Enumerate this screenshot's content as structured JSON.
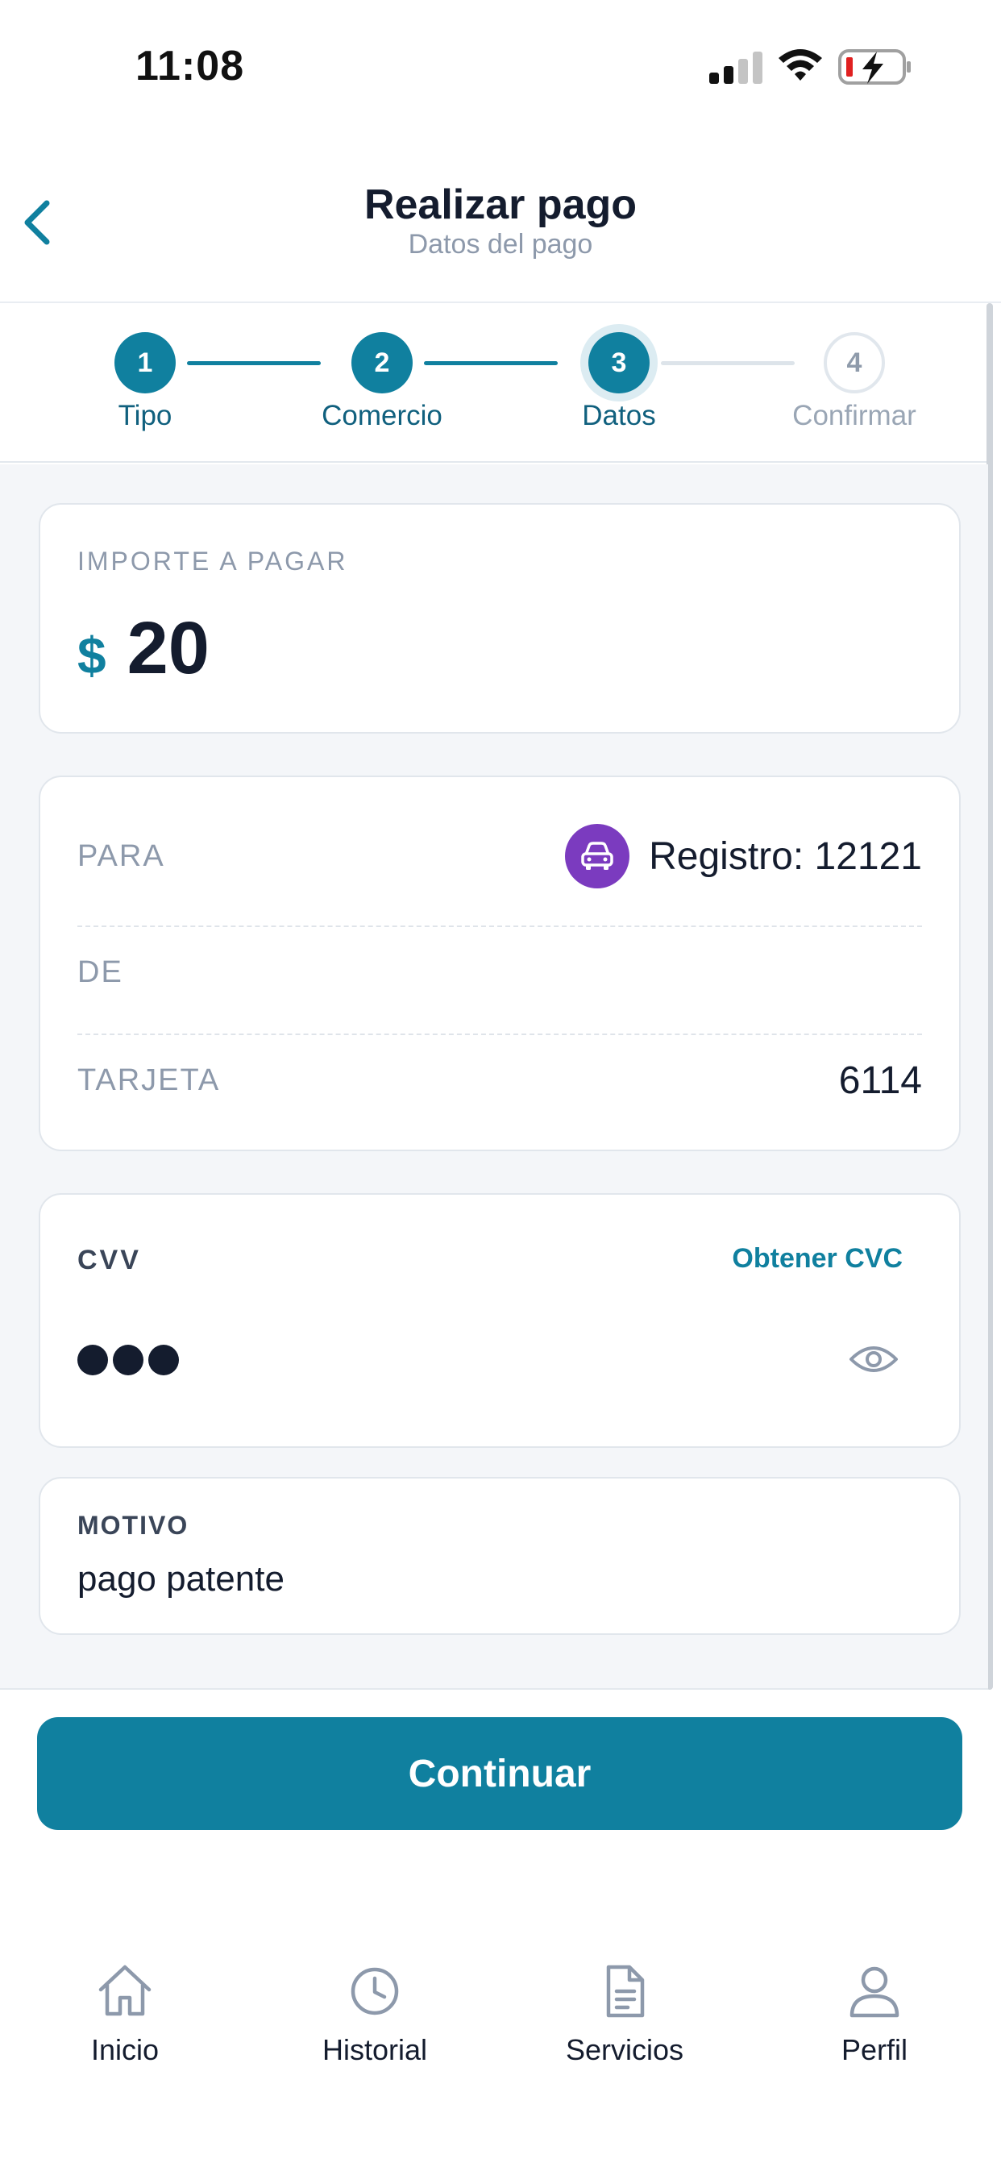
{
  "status_bar": {
    "time": "11:08"
  },
  "header": {
    "title": "Realizar pago",
    "subtitle": "Datos del pago"
  },
  "stepper": {
    "steps": [
      {
        "number": "1",
        "label": "Tipo",
        "state": "done"
      },
      {
        "number": "2",
        "label": "Comercio",
        "state": "done"
      },
      {
        "number": "3",
        "label": "Datos",
        "state": "current"
      },
      {
        "number": "4",
        "label": "Confirmar",
        "state": "todo"
      }
    ]
  },
  "amount": {
    "label": "IMPORTE A PAGAR",
    "currency": "$",
    "value": "20"
  },
  "details": {
    "para_label": "PARA",
    "para_value": "Registro: 12121",
    "de_label": "DE",
    "tarjeta_label": "TARJETA",
    "tarjeta_value": "6114"
  },
  "cvv": {
    "label": "CVV",
    "link": "Obtener CVC",
    "masked_length": 3
  },
  "motivo": {
    "label": "MOTIVO",
    "value": "pago patente"
  },
  "continue_label": "Continuar",
  "tabs": [
    {
      "label": "Inicio",
      "icon": "home-icon"
    },
    {
      "label": "Historial",
      "icon": "clock-icon"
    },
    {
      "label": "Servicios",
      "icon": "document-icon"
    },
    {
      "label": "Perfil",
      "icon": "user-icon"
    }
  ],
  "colors": {
    "accent": "#10809f",
    "car_badge": "#7b3bbf",
    "text_dark": "#141c2e",
    "text_muted": "#8d99ab",
    "background": "#f4f6f9"
  }
}
